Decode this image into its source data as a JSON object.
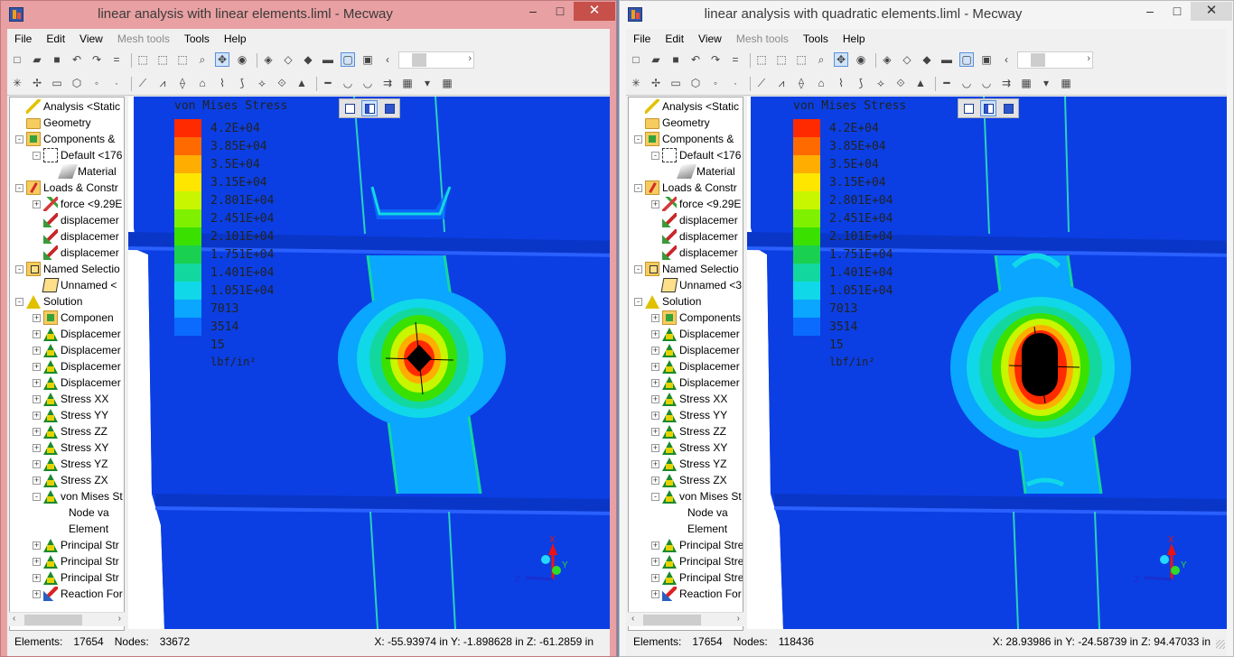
{
  "menu": [
    "File",
    "Edit",
    "View",
    "Mesh tools",
    "Tools",
    "Help"
  ],
  "tree_labels": {
    "analysis": "Analysis <Static",
    "geometry": "Geometry",
    "components": "Components &",
    "default": "Default <176",
    "material": "Material",
    "loads": "Loads & Constr",
    "force": "force <9.29E",
    "disp1": "displacemer",
    "disp2": "displacemer",
    "disp3": "displacemer",
    "named": "Named Selectio",
    "unnamed": "Unnamed <",
    "solution": "Solution",
    "sol_components": "Component",
    "displacement": "Displacemer",
    "stress_xx": "Stress XX",
    "stress_yy": "Stress YY",
    "stress_zz": "Stress ZZ",
    "stress_xy": "Stress XY",
    "stress_yz": "Stress YZ",
    "stress_zx": "Stress ZX",
    "von_mises": "von Mises St",
    "node_values": "Node va",
    "element_values": "Element",
    "principal": "Principal Str",
    "reaction": "Reaction For"
  },
  "legend": {
    "title": "von Mises Stress",
    "unit": "lbf/in²",
    "colors": [
      "#ff2a00",
      "#ff6a00",
      "#ffad00",
      "#ffe600",
      "#c8f500",
      "#7ef000",
      "#39e000",
      "#1ad050",
      "#12d8a0",
      "#10d8e8",
      "#0aa6ff",
      "#0b6bff",
      "#0b3fe3"
    ],
    "labels": [
      "4.2E+04",
      "3.85E+04",
      "3.5E+04",
      "3.15E+04",
      "2.801E+04",
      "2.451E+04",
      "2.101E+04",
      "1.751E+04",
      "1.401E+04",
      "1.051E+04",
      "7013",
      "3514",
      "15"
    ]
  },
  "axis_labels": {
    "x": "X",
    "y": "Y",
    "z": "Z"
  },
  "left": {
    "title": "linear analysis with linear elements.liml - Mecway",
    "status": {
      "elements_label": "Elements:",
      "elements": "17654",
      "nodes_label": "Nodes:",
      "nodes": "33672",
      "coords": "X: -55.93974 in Y: -1.898628 in Z: -61.2859 in"
    },
    "tree_extra": {
      "unnamed": "Unnamed <",
      "sol_components": "Componen",
      "principal": "Principal Str",
      "reaction": "Reaction For"
    }
  },
  "right": {
    "title": "linear analysis with quadratic elements.liml - Mecway",
    "status": {
      "elements_label": "Elements:",
      "elements": "17654",
      "nodes_label": "Nodes:",
      "nodes": "118436",
      "coords": "X: 28.93986 in Y: -24.58739 in Z: 94.47033 in"
    },
    "tree_extra": {
      "unnamed": "Unnamed <3",
      "sol_components": "Components",
      "principal": "Principal Stre",
      "reaction": "Reaction For"
    }
  },
  "icons": {
    "minimize": "minimize-icon",
    "maximize": "maximize-icon",
    "close": "close-icon"
  }
}
